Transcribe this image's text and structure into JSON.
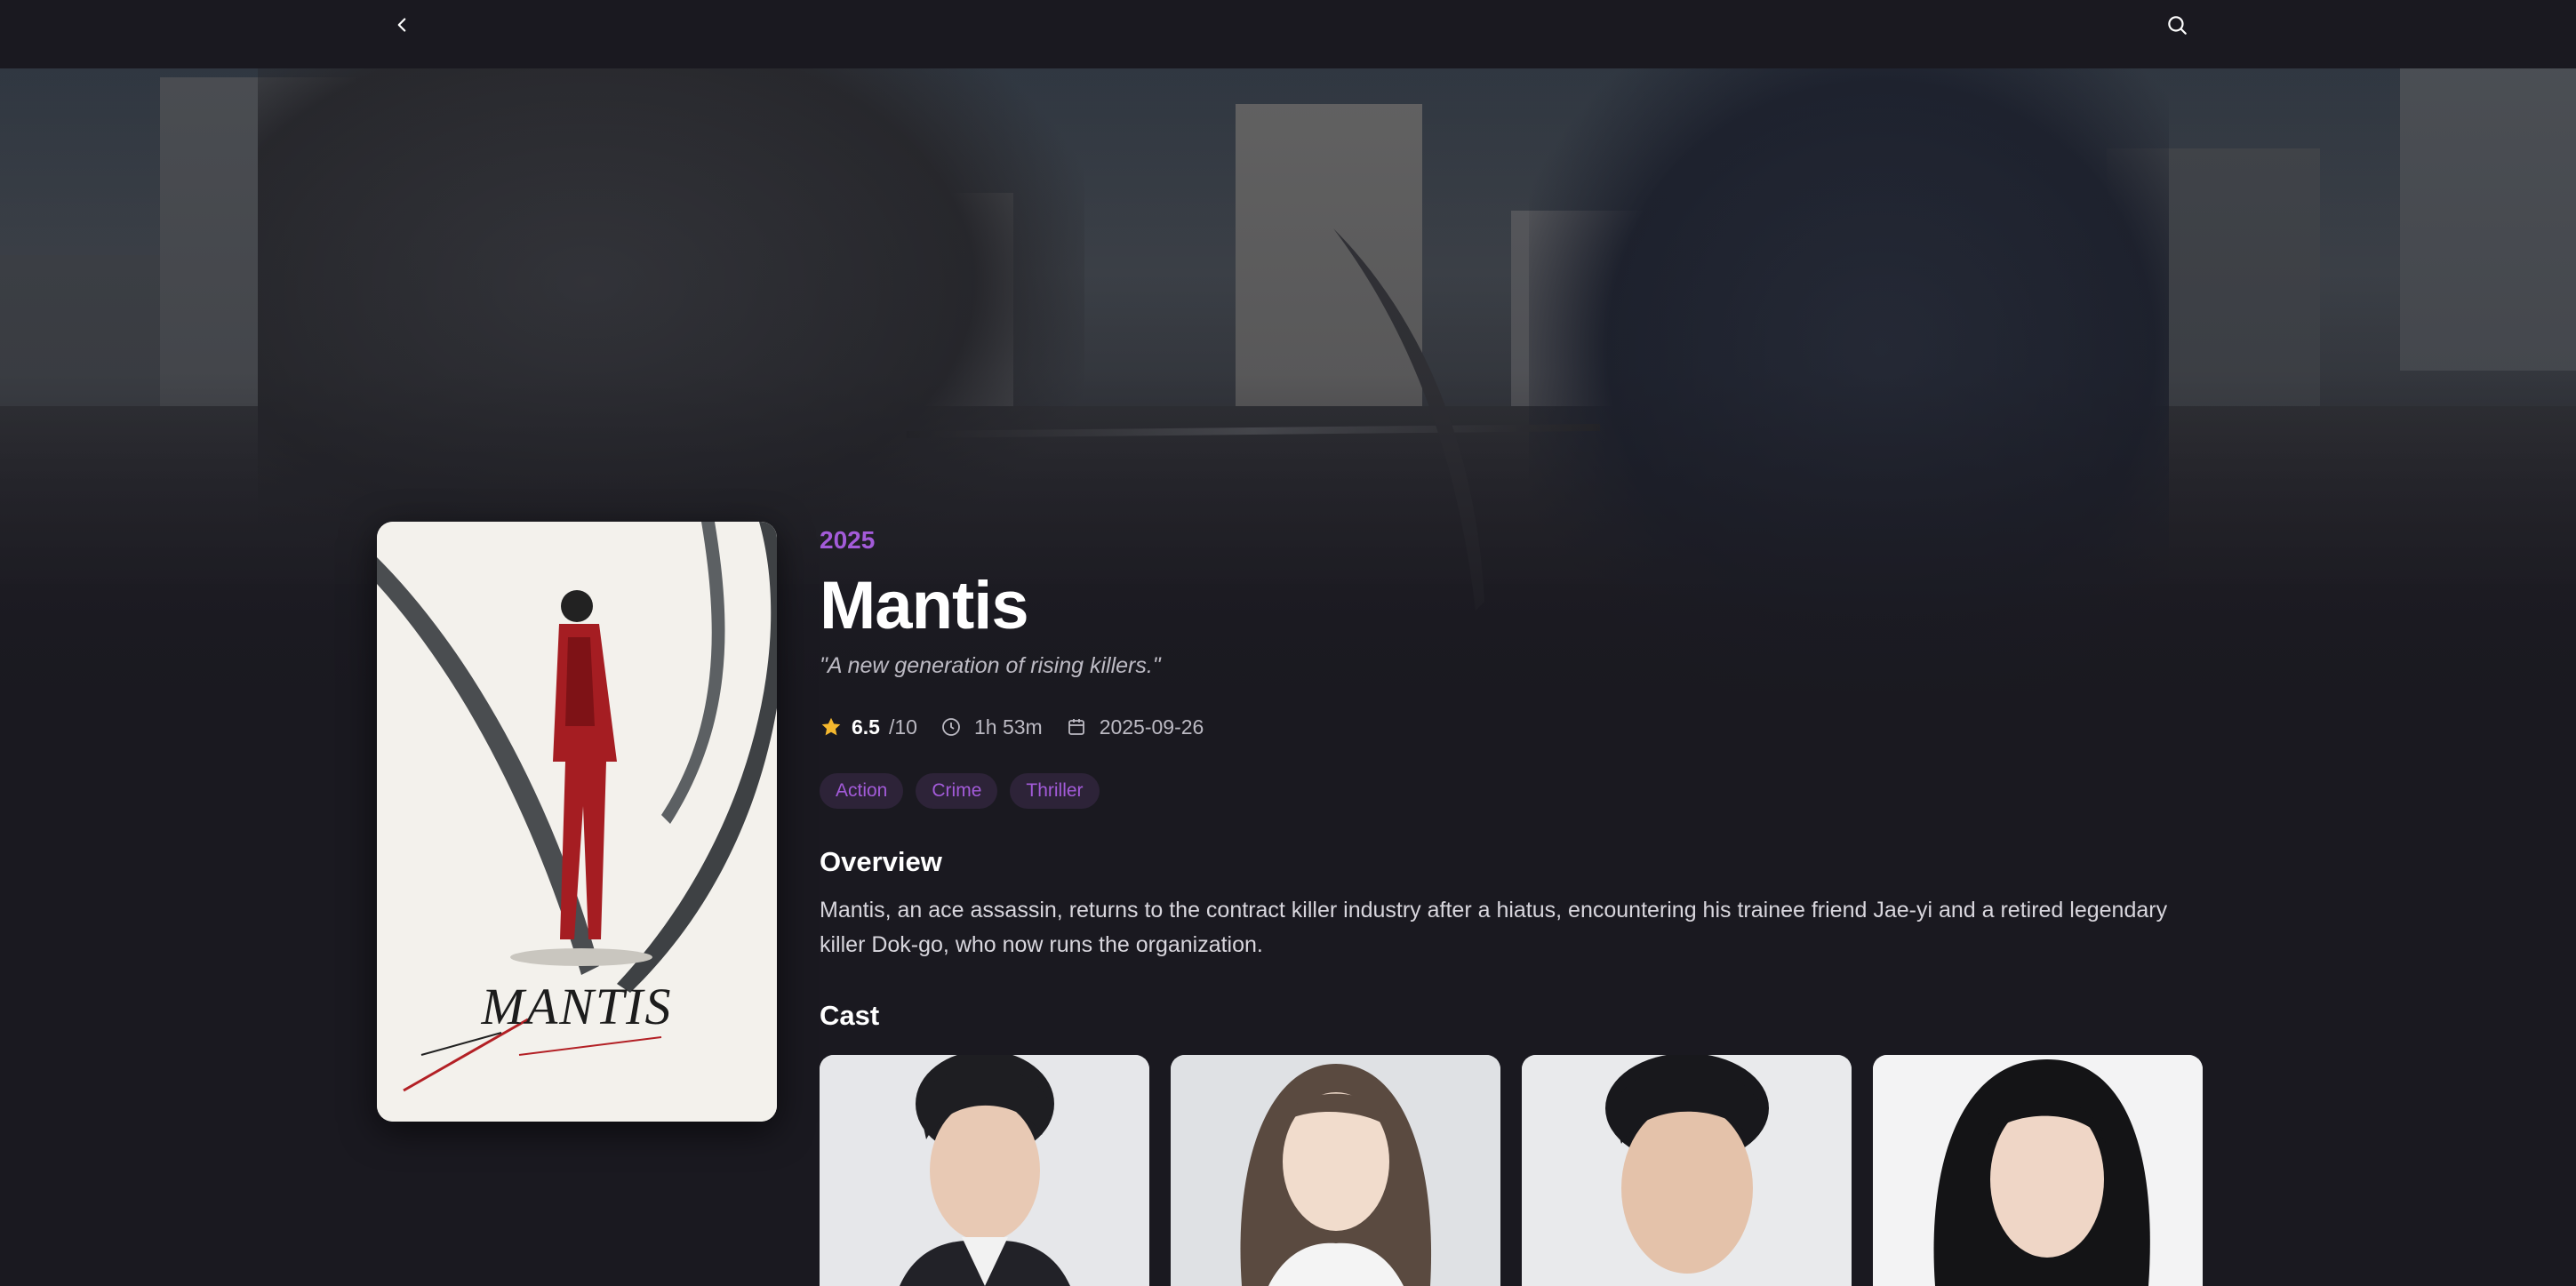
{
  "nav": {
    "back_icon": "chevron-left-icon",
    "search_icon": "search-icon"
  },
  "movie": {
    "year": "2025",
    "title": "Mantis",
    "tagline": "\"A new generation of rising killers.\"",
    "rating": "6.5",
    "rating_max": "/10",
    "runtime": "1h 53m",
    "release_date": "2025-09-26",
    "genres": [
      "Action",
      "Crime",
      "Thriller"
    ],
    "overview_heading": "Overview",
    "overview": "Mantis, an ace assassin, returns to the contract killer industry after a hiatus, encountering his trainee friend Jae-yi and a retired legendary killer Dok-go, who now runs the organization.",
    "cast_heading": "Cast",
    "poster_wordmark": "MANTIS"
  },
  "colors": {
    "accent": "#a35bd9",
    "star": "#f5b82e",
    "background": "#1a1920",
    "genre_chip_bg": "#2d2338"
  },
  "cast": [
    {
      "photo": "cast-photo-1"
    },
    {
      "photo": "cast-photo-2"
    },
    {
      "photo": "cast-photo-3"
    },
    {
      "photo": "cast-photo-4"
    }
  ]
}
